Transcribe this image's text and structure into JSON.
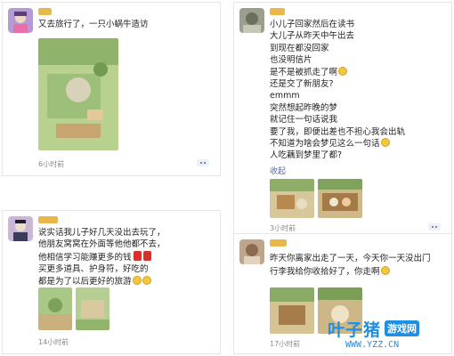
{
  "posts": [
    {
      "lines": [
        "又去旅行了，一只小蜗牛造访"
      ],
      "time": "6小时前"
    },
    {
      "lines": [
        "小儿子回家然后在读书",
        "大儿子从昨天中午出去",
        "到现在都没回家",
        "也没明信片",
        "是不是被抓走了啊",
        "还是交了新朋友?",
        "emmm",
        "突然想起昨晚的梦",
        "就记住一句话说我",
        "要了我，即便出差也不担心我会出轨",
        "不知道为啥会梦见这么一句话",
        "人吃藕到梦里了都?"
      ],
      "collect": "收起",
      "time": "3小时前"
    },
    {
      "lines": [
        "说实话我儿子好几天没出去玩了，",
        "他朋友窝窝在外面等他他都不去，",
        "他相信学习能赚更多的钱",
        "买更多道具、护身符，好吃的",
        "都是为了以后更好的旅游"
      ],
      "time": "14小时前"
    },
    {
      "lines": [
        "昨天你离家出走了一天，今天你一天没出门",
        "行李我给你收拾好了，你走啊"
      ],
      "time": "17小时前"
    }
  ],
  "watermark": {
    "brand": "叶子猪",
    "badge": "游戏网",
    "url": "WWW.YZZ.CN"
  },
  "colors": {
    "link": "#586b94",
    "timestamp": "#888888",
    "username_blur": "#e8b84a",
    "watermark": "#1f8fe3"
  }
}
